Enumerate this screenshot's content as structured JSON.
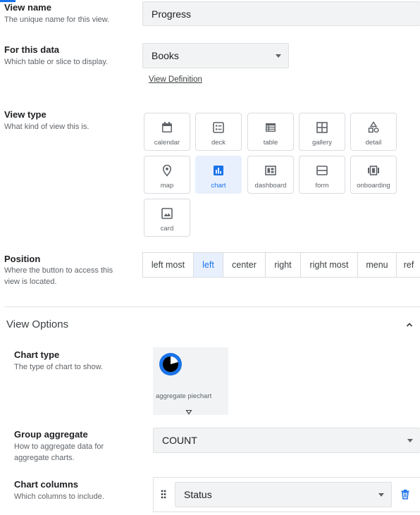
{
  "view_name": {
    "title": "View name",
    "desc": "The unique name for this view.",
    "value": "Progress"
  },
  "for_data": {
    "title": "For this data",
    "desc": "Which table or slice to display.",
    "value": "Books",
    "link": "View Definition"
  },
  "view_type": {
    "title": "View type",
    "desc": "What kind of view this is.",
    "options": [
      {
        "label": "calendar",
        "icon": "calendar-icon"
      },
      {
        "label": "deck",
        "icon": "deck-icon"
      },
      {
        "label": "table",
        "icon": "table-icon"
      },
      {
        "label": "gallery",
        "icon": "gallery-icon"
      },
      {
        "label": "detail",
        "icon": "detail-icon"
      },
      {
        "label": "map",
        "icon": "map-pin-icon"
      },
      {
        "label": "chart",
        "icon": "bar-chart-icon"
      },
      {
        "label": "dashboard",
        "icon": "dashboard-icon"
      },
      {
        "label": "form",
        "icon": "form-icon"
      },
      {
        "label": "onboarding",
        "icon": "onboarding-icon"
      },
      {
        "label": "card",
        "icon": "card-icon"
      }
    ],
    "selected": "chart"
  },
  "position": {
    "title": "Position",
    "desc": "Where the button to access this view is located.",
    "options": [
      "left most",
      "left",
      "center",
      "right",
      "right most",
      "menu",
      "ref"
    ],
    "selected": "left"
  },
  "view_options": {
    "title": "View Options",
    "chart_type": {
      "title": "Chart type",
      "desc": "The type of chart to show.",
      "value": "aggregate piechart"
    },
    "group_aggregate": {
      "title": "Group aggregate",
      "desc": "How to aggregate data for aggregate charts.",
      "value": "COUNT"
    },
    "chart_columns": {
      "title": "Chart columns",
      "desc": "Which columns to include.",
      "value": "Status"
    }
  },
  "colors": {
    "accent": "#1a73e8",
    "selected_bg": "#e8f0fe",
    "field_bg": "#f1f3f4",
    "pie_blue": "#1a73e8"
  }
}
